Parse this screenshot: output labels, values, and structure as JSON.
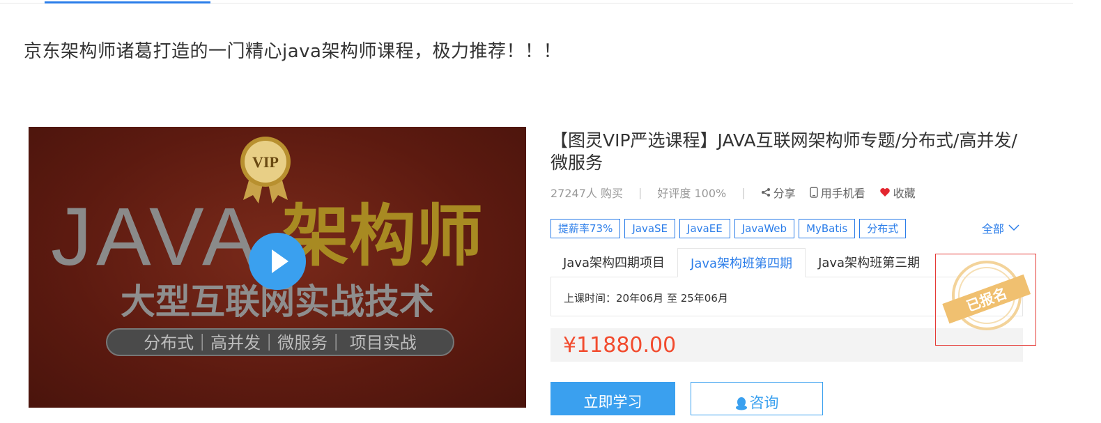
{
  "description": "京东架构师诸葛打造的一门精心java架构师课程，极力推荐！！！",
  "cover": {
    "badge": "VIP",
    "title_en": "JAVA",
    "title_cn": "架构师",
    "subtitle": "大型互联网实战技术",
    "tagline": "分布式｜高并发｜微服务｜ 项目实战"
  },
  "course": {
    "title": "【图灵VIP严选课程】JAVA互联网架构师专题/分布式/高并发/微服务",
    "buyers": "27247人 购买",
    "rating": "好评度 100%",
    "share_label": "分享",
    "mobile_label": "用手机看",
    "favorite_label": "收藏",
    "tags": [
      "提薪率73%",
      "JavaSE",
      "JavaEE",
      "JavaWeb",
      "MyBatis",
      "分布式"
    ],
    "all_label": "全部",
    "tabs": [
      "Java架构四期项目",
      "Java架构班第四期",
      "Java架构班第三期"
    ],
    "schedule": "上课时间：20年06月 至 25年06月",
    "stamp_text": "已报名",
    "price": "¥11880.00",
    "learn_button": "立即学习",
    "consult_button": "咨询"
  },
  "colors": {
    "accent": "#2b7de9",
    "price": "#f24b2e",
    "button": "#3aa0ef",
    "stamp": "#f0c070"
  }
}
